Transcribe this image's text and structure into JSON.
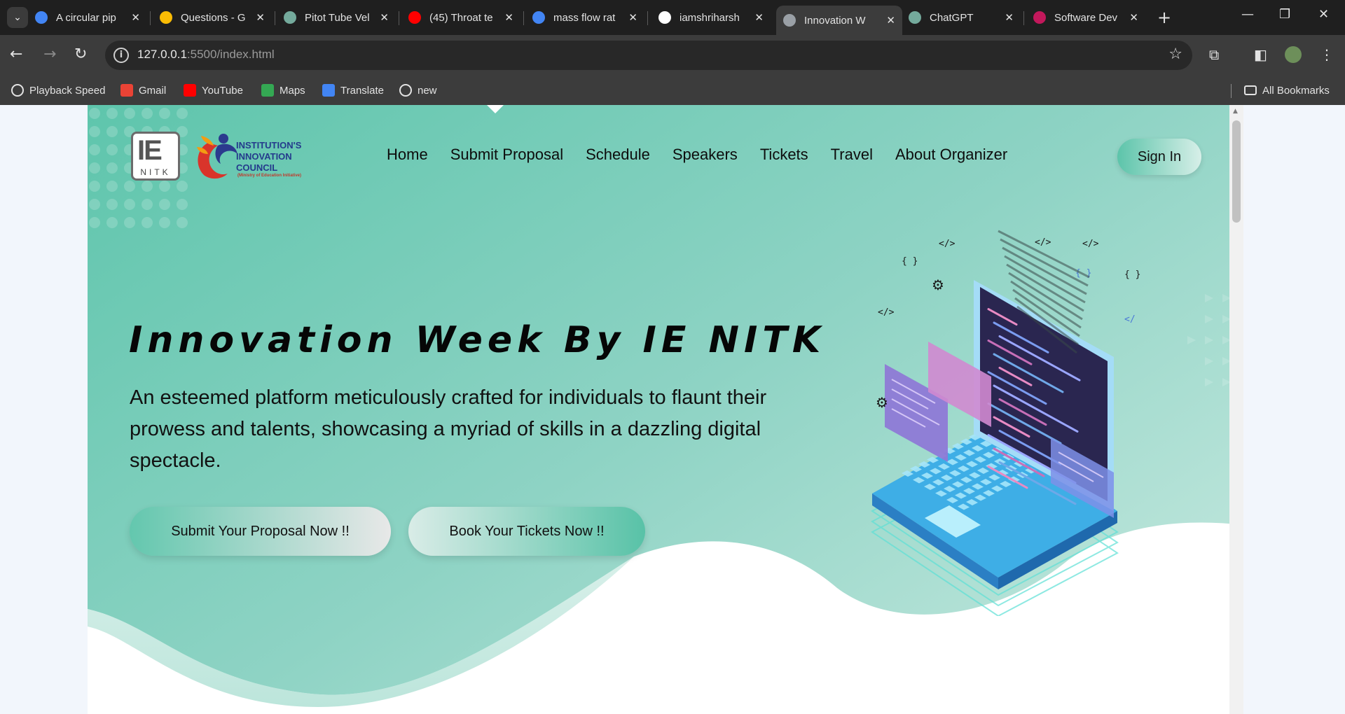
{
  "browser": {
    "tabs": [
      {
        "title": "A circular pip",
        "icon": "google-icon",
        "color": "#4285f4",
        "active": false
      },
      {
        "title": "Questions - G",
        "icon": "google-drive-icon",
        "color": "#fbbc04",
        "active": false
      },
      {
        "title": "Pitot Tube Vel",
        "icon": "chatgpt-icon",
        "color": "#74aa9c",
        "active": false
      },
      {
        "title": "(45) Throat te",
        "icon": "youtube-icon",
        "color": "#ff0000",
        "active": false
      },
      {
        "title": "mass flow rat",
        "icon": "google-icon",
        "color": "#4285f4",
        "active": false
      },
      {
        "title": "iamshriharsh",
        "icon": "github-icon",
        "color": "#ffffff",
        "active": false
      },
      {
        "title": "Innovation W",
        "icon": "page-icon",
        "color": "#9aa0a6",
        "active": true
      },
      {
        "title": "ChatGPT",
        "icon": "chatgpt-icon",
        "color": "#74aa9c",
        "active": false
      },
      {
        "title": "Software Dev",
        "icon": "rgs-icon",
        "color": "#c2185b",
        "active": false
      }
    ],
    "new_tab": "+",
    "url_host": "127.0.0.1",
    "url_rest": ":5500/index.html",
    "bookmarks": [
      {
        "label": "Playback Speed",
        "icon": "globe-icon",
        "color": "#e3e3e3"
      },
      {
        "label": "Gmail",
        "icon": "gmail-icon",
        "color": "#ea4335"
      },
      {
        "label": "YouTube",
        "icon": "youtube-icon",
        "color": "#ff0000"
      },
      {
        "label": "Maps",
        "icon": "maps-icon",
        "color": "#34a853"
      },
      {
        "label": "Translate",
        "icon": "translate-icon",
        "color": "#4285f4"
      },
      {
        "label": "new",
        "icon": "globe-icon",
        "color": "#e3e3e3"
      }
    ],
    "all_bookmarks": "All Bookmarks"
  },
  "site": {
    "logo_ie": "IE",
    "logo_nitk": "NITK",
    "iic_lines": [
      "INSTITUTION'S",
      "INNOVATION",
      "COUNCIL"
    ],
    "iic_sub": "(Ministry of Education Initiative)",
    "nav": [
      "Home",
      "Submit Proposal",
      "Schedule",
      "Speakers",
      "Tickets",
      "Travel",
      "About Organizer"
    ],
    "sign_in": "Sign In",
    "title": "Innovation Week By IE NITK",
    "description": "An esteemed platform meticulously crafted for individuals to flaunt their prowess and talents, showcasing a myriad of skills in a dazzling digital spectacle.",
    "cta_primary": "Submit Your Proposal Now !!",
    "cta_secondary": "Book Your Tickets Now !!",
    "colors": {
      "hero_start": "#5cc4aa",
      "hero_end": "#b9e3d8",
      "accent": "#62c6ad"
    }
  }
}
